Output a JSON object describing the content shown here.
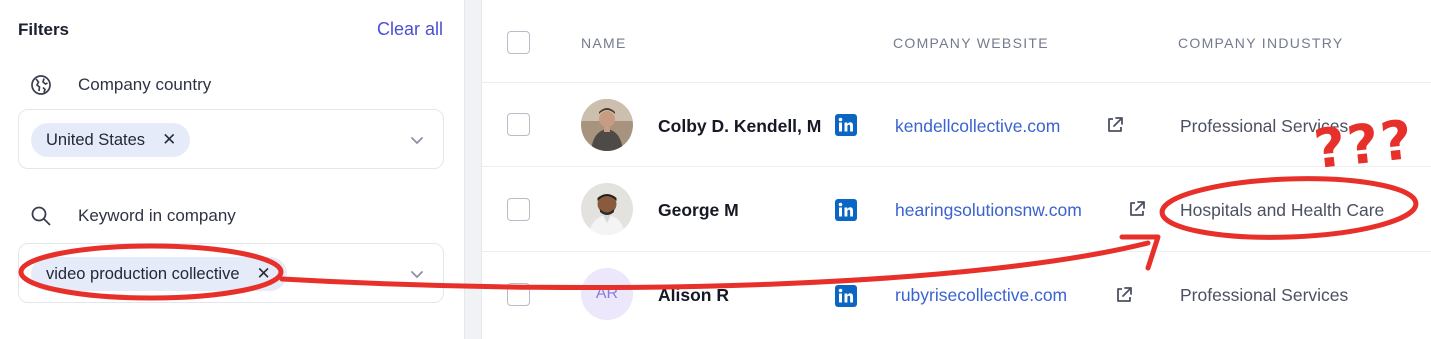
{
  "filters": {
    "title": "Filters",
    "clear_all": "Clear all",
    "company_country": {
      "label": "Company country",
      "icon": "globe-icon",
      "chip": "United States"
    },
    "keyword": {
      "label": "Keyword in company",
      "icon": "search-icon",
      "chip": "video production collective"
    }
  },
  "table": {
    "headers": [
      "NAME",
      "COMPANY WEBSITE",
      "COMPANY INDUSTRY"
    ],
    "rows": [
      {
        "name": "Colby D. Kendell, M",
        "avatar": "photo",
        "website": "kendellcollective.com",
        "industry": "Professional Services"
      },
      {
        "name": "George M",
        "avatar": "photo",
        "website": "hearingsolutionsnw.com",
        "industry": "Hospitals and Health Care"
      },
      {
        "name": "Alison R",
        "avatar_initials": "AR",
        "website": "rubyrisecollective.com",
        "industry": "Professional Services"
      }
    ]
  },
  "annotation": {
    "marks": "???",
    "color": "#e8302b"
  },
  "colors": {
    "accent": "#4b4fd6",
    "link": "#3a63d0",
    "chip_bg": "#e5ebf8",
    "linkedin": "#0a66c2"
  }
}
